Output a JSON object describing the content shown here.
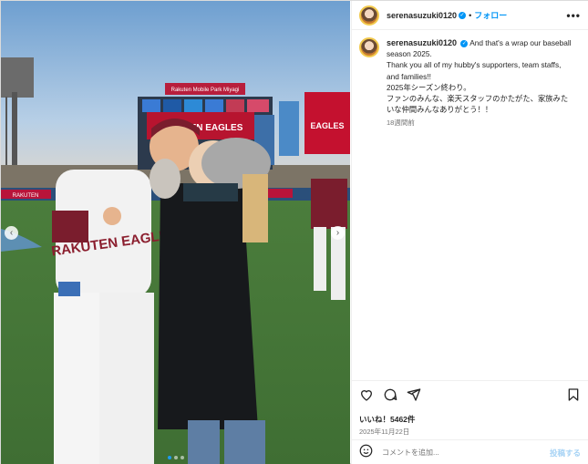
{
  "post": {
    "username": "serenasuzuki0120",
    "separator": "•",
    "follow_label": "フォロー",
    "more_label": "•••",
    "caption_lines": [
      "And that's a wrap our baseball",
      "season 2025.",
      "Thank you all of my hubby's supporters, team staffs,",
      "and families!!",
      "2025年シーズン終わり。",
      "ファンのみんな、楽天スタッフのかたがた、家族みた",
      "いな仲間みんなありがとう！！"
    ],
    "time_ago": "18週間前",
    "likes": "いいね！5462件",
    "date": "2025年11月22日",
    "comment_placeholder": "コメントを追加...",
    "post_label": "投稿する"
  },
  "photo": {
    "stadium_banner": "Rakuten Mobile Park Miyagi",
    "scoreboard_text": "RAKUTEN EAGLES",
    "jersey_text": "RAKUTEN EAGLES",
    "ad_text": "RAKUTEN",
    "board_right": "EAGLES"
  },
  "colors": {
    "accent": "#0095f6",
    "crimson": "#8b1e2e"
  },
  "icons": [
    "heart-icon",
    "comment-icon",
    "share-icon",
    "save-icon",
    "emoji-icon",
    "more-icon",
    "verified-icon",
    "chevron-left-icon",
    "chevron-right-icon"
  ]
}
